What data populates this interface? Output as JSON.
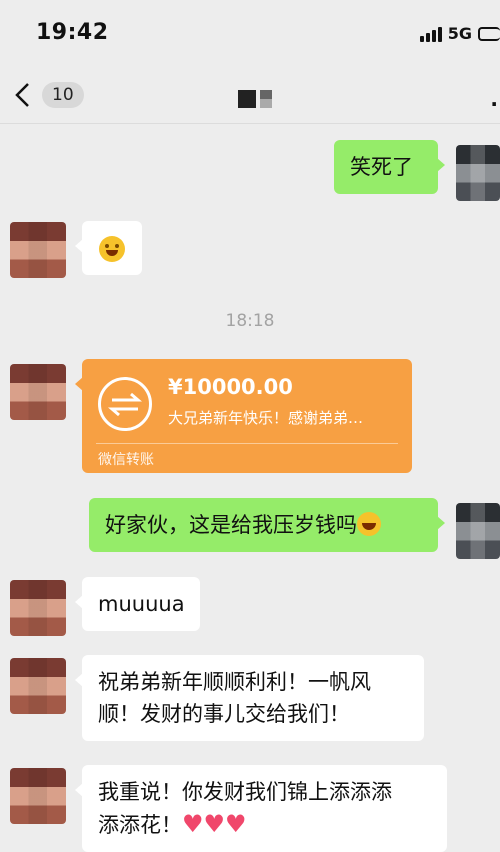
{
  "status": {
    "time": "19:42",
    "network": "5G"
  },
  "nav": {
    "unread": "10"
  },
  "messages": {
    "m1": "笑死了",
    "time_sep": "18:18",
    "m3": "好家伙，这是给我压岁钱吗",
    "m4": "muuuua",
    "m5_line1": "祝弟弟新年顺顺利利！一帆风",
    "m5_line2": "顺！发财的事儿交给我们！",
    "m6_line1": "我重说！你发财我们锦上添添添",
    "m6_line2": "添添花！"
  },
  "transfer": {
    "amount": "¥10000.00",
    "note": "大兄弟新年快乐！感谢弟弟…",
    "footer": "微信转账"
  },
  "icons": {
    "back": "chevron-left-icon",
    "more": "more-icon",
    "transfer": "transfer-arrows-icon",
    "emoji": "emoji-icon",
    "heart": "heart-icon"
  },
  "colors": {
    "background": "#ededed",
    "my_bubble": "#95ec69",
    "their_bubble": "#ffffff",
    "transfer": "#f7a043"
  }
}
